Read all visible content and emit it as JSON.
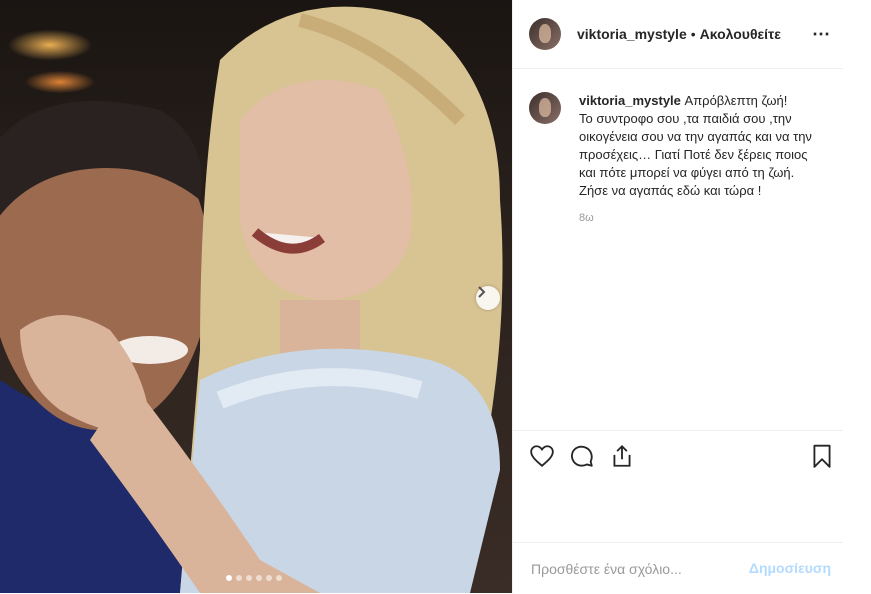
{
  "post": {
    "username": "viktoria_mystyle",
    "separator": "•",
    "follow_label": "Ακολουθείτε",
    "more_icon": "⋯",
    "caption_lines": "Απρόβλεπτη ζωή!\nΤο συντροφο σου ,τα παιδιά σου ,την οικογένεια σου να την αγαπάς και να την προσέχεις… Γιατί Ποτέ δεν ξέρεις ποιος και πότε μπορεί να φύγει από τη ζωή.\nΖήσε να αγαπάς εδώ και τώρα !",
    "time_ago": "8ω",
    "carousel": {
      "count": 6,
      "active_index": 0
    }
  },
  "actions": {
    "like_icon": "heart-icon",
    "comment_icon": "comment-icon",
    "share_icon": "share-icon",
    "save_icon": "bookmark-icon"
  },
  "comment": {
    "placeholder": "Προσθέστε ένα σχόλιο...",
    "post_label": "Δημοσίευση",
    "post_color": "#b3dbff"
  }
}
